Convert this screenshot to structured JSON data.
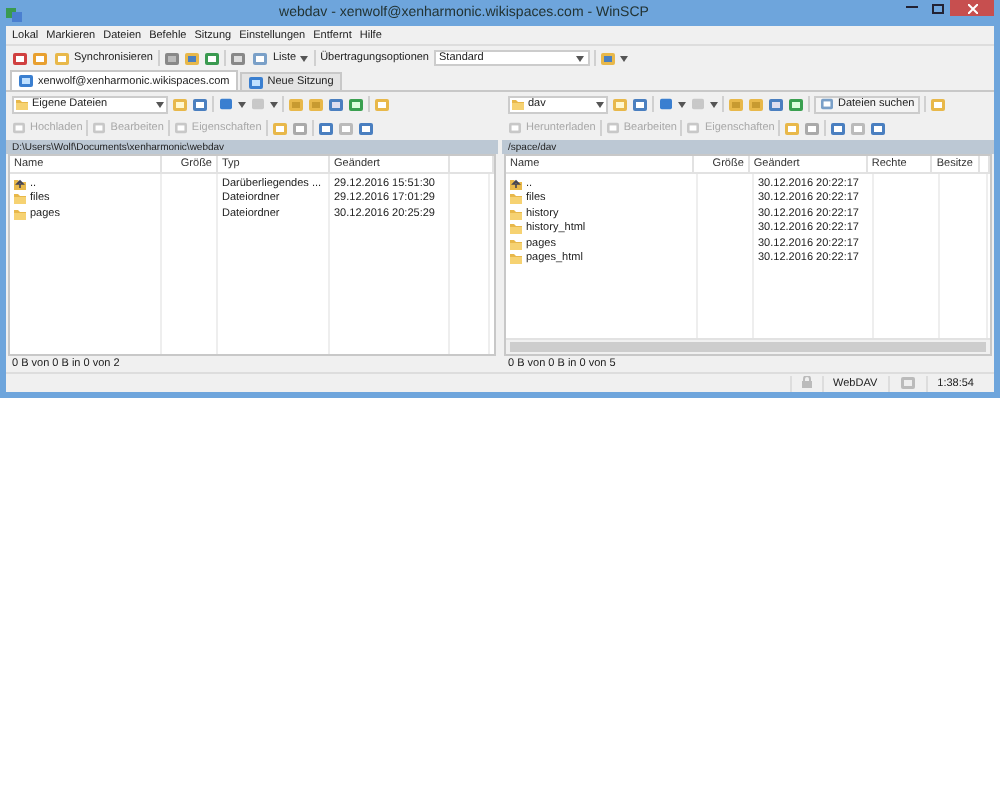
{
  "window": {
    "title": "webdav - xenwolf@xenharmonic.wikispaces.com - WinSCP"
  },
  "menu": [
    "Lokal",
    "Markieren",
    "Dateien",
    "Befehle",
    "Sitzung",
    "Einstellungen",
    "Entfernt",
    "Hilfe"
  ],
  "toolbar": {
    "synchronize": "Synchronisieren",
    "view": "Liste",
    "transfer_label": "Übertragungsoptionen",
    "transfer_value": "Standard"
  },
  "tabs": [
    {
      "label": "xenwolf@xenharmonic.wikispaces.com",
      "selected": true
    },
    {
      "label": "Neue Sitzung",
      "selected": false
    }
  ],
  "panes": [
    {
      "location": "Eigene Dateien",
      "actions": [
        {
          "label": "Hochladen",
          "disabled": true
        },
        {
          "label": "Bearbeiten",
          "disabled": true
        },
        {
          "label": "Eigenschaften",
          "disabled": true
        }
      ],
      "path": "D:\\Users\\Wolf\\Documents\\xenharmonic\\webdav",
      "columns": [
        "Name",
        "Größe",
        "Typ",
        "Geändert"
      ],
      "rows": [
        {
          "kind": "parent",
          "cells": [
            "..",
            "",
            "Darüberliegendes ...",
            "29.12.2016  15:51:30"
          ]
        },
        {
          "kind": "folder",
          "cells": [
            "files",
            "",
            "Dateiordner",
            "29.12.2016  17:01:29"
          ]
        },
        {
          "kind": "folder",
          "cells": [
            "pages",
            "",
            "Dateiordner",
            "30.12.2016  20:25:29"
          ]
        }
      ],
      "status": "0 B von 0 B in 0 von 2"
    },
    {
      "location": "dav",
      "find": "Dateien suchen",
      "actions": [
        {
          "label": "Herunterladen",
          "disabled": true
        },
        {
          "label": "Bearbeiten",
          "disabled": true
        },
        {
          "label": "Eigenschaften",
          "disabled": true
        }
      ],
      "path": "/space/dav",
      "columns": [
        "Name",
        "Größe",
        "Geändert",
        "Rechte",
        "Besitze"
      ],
      "rows": [
        {
          "kind": "parent",
          "cells": [
            "..",
            "",
            "30.12.2016 20:22:17",
            "",
            ""
          ]
        },
        {
          "kind": "folder",
          "cells": [
            "files",
            "",
            "30.12.2016 20:22:17",
            "",
            ""
          ]
        },
        {
          "kind": "folder",
          "cells": [
            "history",
            "",
            "30.12.2016 20:22:17",
            "",
            ""
          ]
        },
        {
          "kind": "folder",
          "cells": [
            "history_html",
            "",
            "30.12.2016 20:22:17",
            "",
            ""
          ]
        },
        {
          "kind": "folder",
          "cells": [
            "pages",
            "",
            "30.12.2016 20:22:17",
            "",
            ""
          ]
        },
        {
          "kind": "folder",
          "cells": [
            "pages_html",
            "",
            "30.12.2016 20:22:17",
            "",
            ""
          ]
        }
      ],
      "status": "0 B von 0 B in 0 von 5"
    }
  ],
  "status_bar": {
    "protocol": "WebDAV",
    "elapsed": "1:38:54"
  }
}
